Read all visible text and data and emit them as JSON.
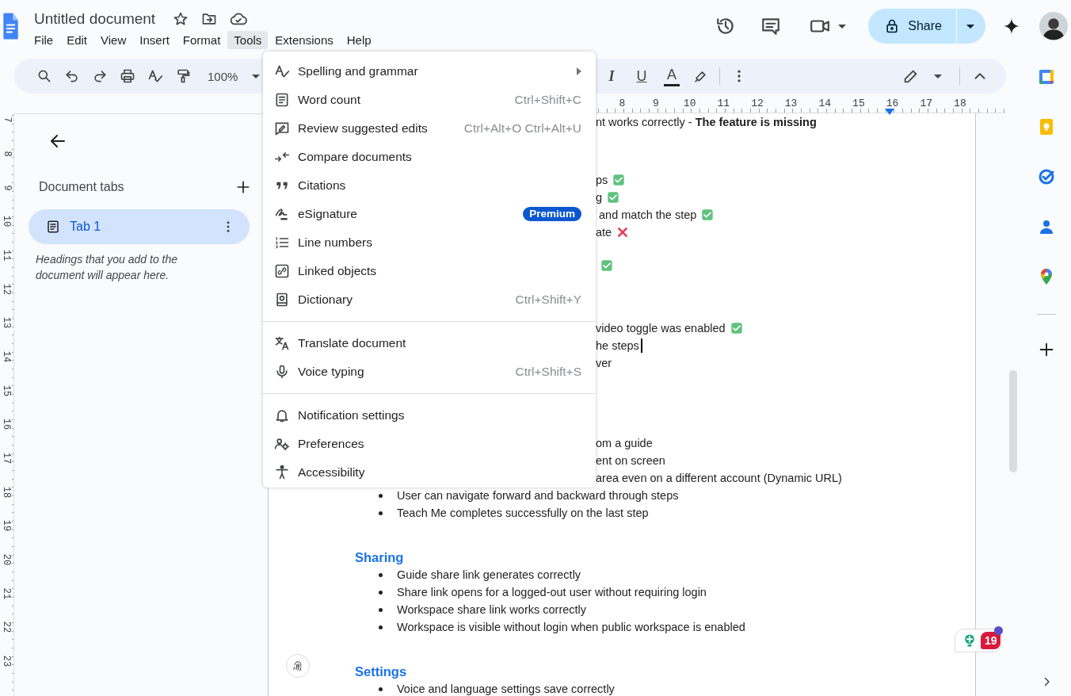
{
  "document": {
    "title": "Untitled document"
  },
  "menu_bar": [
    {
      "label": "File",
      "selected": false
    },
    {
      "label": "Edit",
      "selected": false
    },
    {
      "label": "View",
      "selected": false
    },
    {
      "label": "Insert",
      "selected": false
    },
    {
      "label": "Format",
      "selected": false
    },
    {
      "label": "Tools",
      "selected": true
    },
    {
      "label": "Extensions",
      "selected": false
    },
    {
      "label": "Help",
      "selected": false
    }
  ],
  "share_button": {
    "label": "Share"
  },
  "toolbar": {
    "zoom": "100%",
    "format_buttons": [
      "I",
      "U",
      "A"
    ]
  },
  "horizontal_ruler": [
    "8",
    "9",
    "10",
    "11",
    "12",
    "13",
    "14",
    "15",
    "16",
    "17",
    "18"
  ],
  "vertical_ruler": [
    "7",
    "8",
    "9",
    "10",
    "11",
    "12",
    "13",
    "14",
    "15",
    "16",
    "17",
    "18",
    "19",
    "20",
    "21",
    "22",
    "23"
  ],
  "sidebar": {
    "heading": "Document tabs",
    "tabs": [
      {
        "label": "Tab 1",
        "selected": true
      }
    ],
    "hint": "Headings that you add to the document will appear here."
  },
  "page": {
    "blocks": [
      {
        "lines": [
          {
            "kind": "partial",
            "text": "nt works correctly - **The feature is missing**"
          }
        ]
      },
      {
        "lines": [
          {
            "kind": "partial",
            "text": "ps",
            "passed": true
          },
          {
            "kind": "partial",
            "text": "g",
            "passed": true
          },
          {
            "kind": "partial",
            "text": " and match the step",
            "passed": true
          },
          {
            "kind": "partial",
            "text": "ate",
            "passed": false
          }
        ]
      },
      {
        "lines": [
          {
            "kind": "partial",
            "passed": true
          }
        ]
      },
      {
        "lines": [
          {
            "kind": "partial",
            "text": "video toggle was enabled",
            "passed": true
          },
          {
            "kind": "partial",
            "text": "he steps",
            "caret": true
          },
          {
            "kind": "partial",
            "text": "ver"
          }
        ]
      },
      {
        "lines": [
          {
            "kind": "partial",
            "text": "om a guide"
          },
          {
            "kind": "partial",
            "text": "ent on screen"
          },
          {
            "kind": "partial",
            "text": "area even on a different account (Dynamic URL)"
          },
          {
            "kind": "bullet",
            "text": "User can navigate forward and backward through steps"
          },
          {
            "kind": "bullet",
            "text": "Teach Me completes successfully on the last step"
          }
        ]
      },
      {
        "lines": [
          {
            "kind": "heading",
            "text": "Sharing"
          },
          {
            "kind": "bullet",
            "text": "Guide share link generates correctly"
          },
          {
            "kind": "bullet",
            "text": "Share link opens for a logged-out user without requiring login"
          },
          {
            "kind": "bullet",
            "text": "Workspace share link works correctly"
          },
          {
            "kind": "bullet",
            "text": "Workspace is visible without login when public workspace is enabled"
          }
        ]
      },
      {
        "lines": [
          {
            "kind": "heading",
            "text": "Settings"
          },
          {
            "kind": "bullet",
            "text": "Voice and language settings save correctly"
          }
        ]
      }
    ]
  },
  "tools_menu": {
    "sections": [
      [
        {
          "kind": "submenu",
          "label": "Spelling and grammar"
        },
        {
          "kind": "command",
          "label": "Word count",
          "shortcut": "Ctrl+Shift+C"
        },
        {
          "kind": "command",
          "label": "Review suggested edits",
          "shortcut": "Ctrl+Alt+O Ctrl+Alt+U"
        },
        {
          "kind": "command",
          "label": "Compare documents"
        },
        {
          "kind": "command",
          "label": "Citations"
        },
        {
          "kind": "premium",
          "label": "eSignature",
          "badge": "Premium"
        },
        {
          "kind": "command",
          "label": "Line numbers"
        },
        {
          "kind": "command",
          "label": "Linked objects"
        },
        {
          "kind": "command",
          "label": "Dictionary",
          "shortcut": "Ctrl+Shift+Y"
        }
      ],
      [
        {
          "kind": "command",
          "label": "Translate document"
        },
        {
          "kind": "command",
          "label": "Voice typing",
          "shortcut": "Ctrl+Shift+S"
        }
      ],
      [
        {
          "kind": "command",
          "label": "Notification settings"
        },
        {
          "kind": "command",
          "label": "Preferences"
        },
        {
          "kind": "command",
          "label": "Accessibility"
        }
      ]
    ]
  },
  "assistant_widget": {
    "count": "19"
  }
}
